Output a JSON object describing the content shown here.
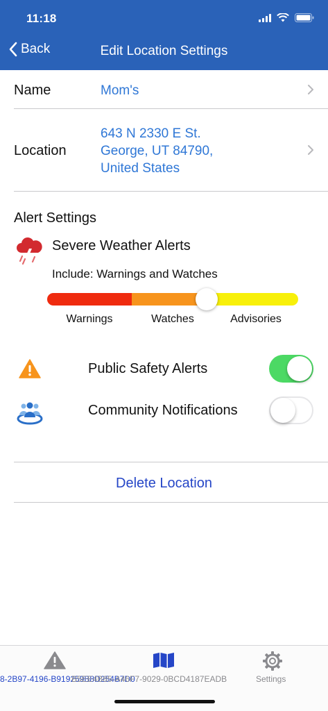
{
  "status_bar": {
    "time": "11:18"
  },
  "nav": {
    "back_label": "Back",
    "title": "Edit Location Settings"
  },
  "name_row": {
    "label": "Name",
    "value": "Mom's"
  },
  "location_row": {
    "label": "Location",
    "lines": [
      "643  N 2330 E St.",
      "George, UT 84790,",
      "United States"
    ]
  },
  "alert_settings": {
    "title": "Alert Settings",
    "severe_weather": {
      "title": "Severe Weather Alerts",
      "include": "Include: Warnings and Watches",
      "levels": [
        "Warnings",
        "Watches",
        "Advisories"
      ],
      "selected_level": "Watches"
    },
    "public_safety": {
      "label": "Public Safety Alerts",
      "enabled": true
    },
    "community": {
      "label": "Community Notifications",
      "enabled": false
    }
  },
  "delete_label": "Delete Location",
  "tab_bar": {
    "tabs": [
      {
        "icon": "warning-triangle-icon",
        "label": "8-2B97-4196-B919259B8D254B7D0",
        "active": false
      },
      {
        "icon": "map-icon",
        "label": "B5EE4B85-A46F7-9029-0BCD4187EADB",
        "active": true
      },
      {
        "icon": "gear-icon",
        "label": "Settings",
        "active": false
      }
    ]
  },
  "colors": {
    "header": "#2a62b8",
    "link": "#2f77d6",
    "delete": "#2546c7",
    "toggle_on": "#4cd964",
    "warnings": "#ef2b0f",
    "watches": "#f7941d",
    "advisories": "#f8f00a"
  }
}
